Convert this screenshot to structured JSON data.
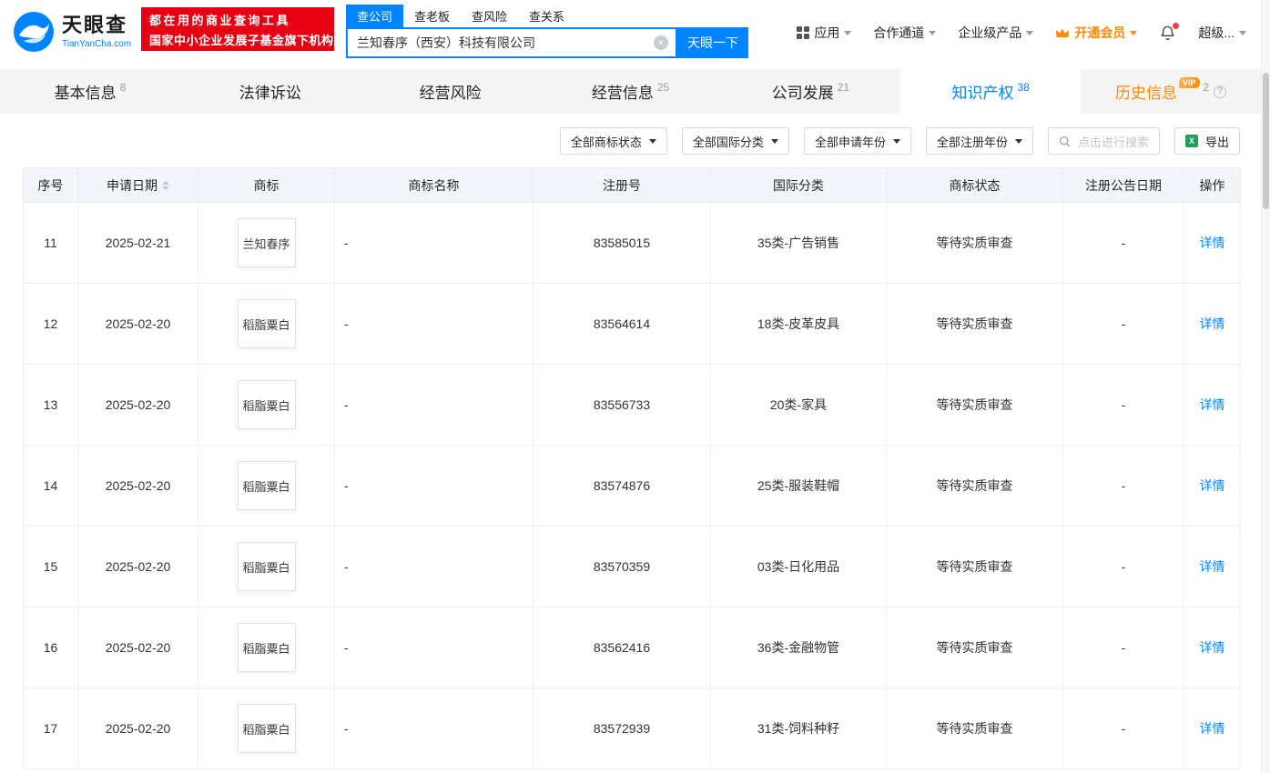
{
  "brand": {
    "accent": "#0084ff",
    "promo_red": "#e60012",
    "vip_orange": "#ff8a00",
    "link_blue": "#0084ff",
    "excel_green": "#1e9e5a"
  },
  "header": {
    "logo": {
      "brand": "天眼查",
      "domain": "TianYanCha.com"
    },
    "promo": {
      "line1": "都在用的商业查询工具",
      "line2": "国家中小企业发展子基金旗下机构"
    },
    "search_tabs": [
      {
        "label": "查公司"
      },
      {
        "label": "查老板"
      },
      {
        "label": "查风险"
      },
      {
        "label": "查关系"
      }
    ],
    "search": {
      "value": "兰知春序（西安）科技有限公司",
      "button": "天眼一下"
    },
    "nav": {
      "apps": "应用",
      "cooperation": "合作通道",
      "enterprise": "企业级产品",
      "vip": "开通会员",
      "account": "超级..."
    }
  },
  "tabs": [
    {
      "label": "基本信息",
      "count": "8"
    },
    {
      "label": "法律诉讼"
    },
    {
      "label": "经营风险"
    },
    {
      "label": "经营信息",
      "count": "25"
    },
    {
      "label": "公司发展",
      "count": "21"
    },
    {
      "label": "知识产权",
      "count": "38"
    },
    {
      "label": "历史信息",
      "count": "2",
      "badge": "VIP"
    }
  ],
  "filters": {
    "status": "全部商标状态",
    "intl_class": "全部国际分类",
    "apply_year": "全部申请年份",
    "register_year": "全部注册年份",
    "search_placeholder": "点击进行搜索",
    "export": "导出"
  },
  "table": {
    "headers": [
      "序号",
      "申请日期",
      "商标",
      "商标名称",
      "注册号",
      "国际分类",
      "商标状态",
      "注册公告日期",
      "操作"
    ],
    "rows": [
      {
        "no": "11",
        "date": "2025-02-21",
        "mark": "兰知春序",
        "name": "-",
        "reg_no": "83585015",
        "intl_class": "35类-广告销售",
        "status": "等待实质审查",
        "pub_date": "-",
        "action": "详情"
      },
      {
        "no": "12",
        "date": "2025-02-20",
        "mark": "稻脂粟白",
        "name": "-",
        "reg_no": "83564614",
        "intl_class": "18类-皮革皮具",
        "status": "等待实质审查",
        "pub_date": "-",
        "action": "详情"
      },
      {
        "no": "13",
        "date": "2025-02-20",
        "mark": "稻脂粟白",
        "name": "-",
        "reg_no": "83556733",
        "intl_class": "20类-家具",
        "status": "等待实质审查",
        "pub_date": "-",
        "action": "详情"
      },
      {
        "no": "14",
        "date": "2025-02-20",
        "mark": "稻脂粟白",
        "name": "-",
        "reg_no": "83574876",
        "intl_class": "25类-服装鞋帽",
        "status": "等待实质审查",
        "pub_date": "-",
        "action": "详情"
      },
      {
        "no": "15",
        "date": "2025-02-20",
        "mark": "稻脂粟白",
        "name": "-",
        "reg_no": "83570359",
        "intl_class": "03类-日化用品",
        "status": "等待实质审查",
        "pub_date": "-",
        "action": "详情"
      },
      {
        "no": "16",
        "date": "2025-02-20",
        "mark": "稻脂粟白",
        "name": "-",
        "reg_no": "83562416",
        "intl_class": "36类-金融物管",
        "status": "等待实质审查",
        "pub_date": "-",
        "action": "详情"
      },
      {
        "no": "17",
        "date": "2025-02-20",
        "mark": "稻脂粟白",
        "name": "-",
        "reg_no": "83572939",
        "intl_class": "31类-饲料种籽",
        "status": "等待实质审查",
        "pub_date": "-",
        "action": "详情"
      }
    ]
  }
}
